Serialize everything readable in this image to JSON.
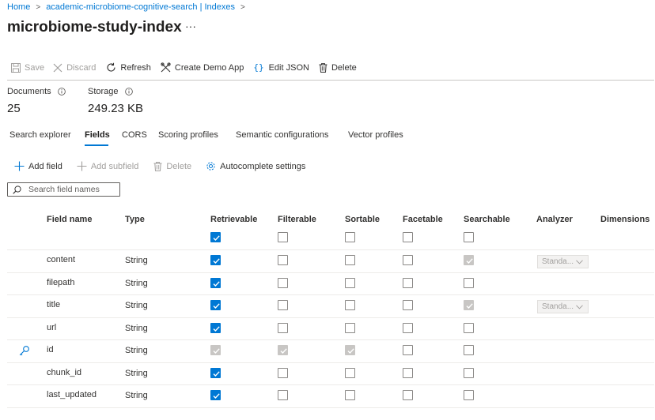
{
  "breadcrumb": {
    "home": "Home",
    "service": "academic-microbiome-cognitive-search | Indexes"
  },
  "page": {
    "title": "microbiome-study-index",
    "more": "···"
  },
  "toolbar": {
    "save": "Save",
    "discard": "Discard",
    "refresh": "Refresh",
    "create_demo_app": "Create Demo App",
    "edit_json": "Edit JSON",
    "delete": "Delete"
  },
  "stats": {
    "documents_label": "Documents",
    "documents_value": "25",
    "storage_label": "Storage",
    "storage_value": "249.23 KB"
  },
  "tabs": [
    "Search explorer",
    "Fields",
    "CORS",
    "Scoring profiles",
    "Semantic configurations",
    "Vector profiles"
  ],
  "active_tab": "Fields",
  "fields_toolbar": {
    "add_field": "Add field",
    "add_subfield": "Add subfield",
    "delete": "Delete",
    "autocomplete": "Autocomplete settings"
  },
  "search": {
    "placeholder": "Search field names"
  },
  "columns": [
    "Field name",
    "Type",
    "Retrievable",
    "Filterable",
    "Sortable",
    "Facetable",
    "Searchable",
    "Analyzer",
    "Dimensions"
  ],
  "header_checks": [
    "checked",
    "unchecked",
    "unchecked",
    "unchecked",
    "unchecked"
  ],
  "rows": [
    {
      "name": "content",
      "type": "String",
      "key": false,
      "checks": [
        "checked",
        "unchecked",
        "unchecked",
        "unchecked",
        "checked-disabled"
      ],
      "analyzer": "Standa..."
    },
    {
      "name": "filepath",
      "type": "String",
      "key": false,
      "checks": [
        "checked",
        "unchecked",
        "unchecked",
        "unchecked",
        "unchecked"
      ],
      "analyzer": ""
    },
    {
      "name": "title",
      "type": "String",
      "key": false,
      "checks": [
        "checked",
        "unchecked",
        "unchecked",
        "unchecked",
        "checked-disabled"
      ],
      "analyzer": "Standa..."
    },
    {
      "name": "url",
      "type": "String",
      "key": false,
      "checks": [
        "checked",
        "unchecked",
        "unchecked",
        "unchecked",
        "unchecked"
      ],
      "analyzer": ""
    },
    {
      "name": "id",
      "type": "String",
      "key": true,
      "checks": [
        "checked-disabled",
        "checked-disabled",
        "checked-disabled",
        "unchecked",
        "unchecked"
      ],
      "analyzer": ""
    },
    {
      "name": "chunk_id",
      "type": "String",
      "key": false,
      "checks": [
        "checked",
        "unchecked",
        "unchecked",
        "unchecked",
        "unchecked"
      ],
      "analyzer": ""
    },
    {
      "name": "last_updated",
      "type": "String",
      "key": false,
      "checks": [
        "checked",
        "unchecked",
        "unchecked",
        "unchecked",
        "unchecked"
      ],
      "analyzer": ""
    }
  ],
  "icons": {
    "save": "save-icon",
    "discard": "discard-icon",
    "refresh": "refresh-icon",
    "create_demo_app": "wrench-icon",
    "edit_json": "braces-icon",
    "delete": "trash-icon",
    "info": "info-icon",
    "add": "plus-icon",
    "autocomplete": "gear-icon",
    "search": "search-icon",
    "key": "key-icon",
    "dropdown": "chevron-down-icon"
  },
  "colors": {
    "accent": "#0078d4",
    "disabled_check": "#c8c6c4",
    "text": "#323130",
    "muted": "#a19f9d"
  }
}
